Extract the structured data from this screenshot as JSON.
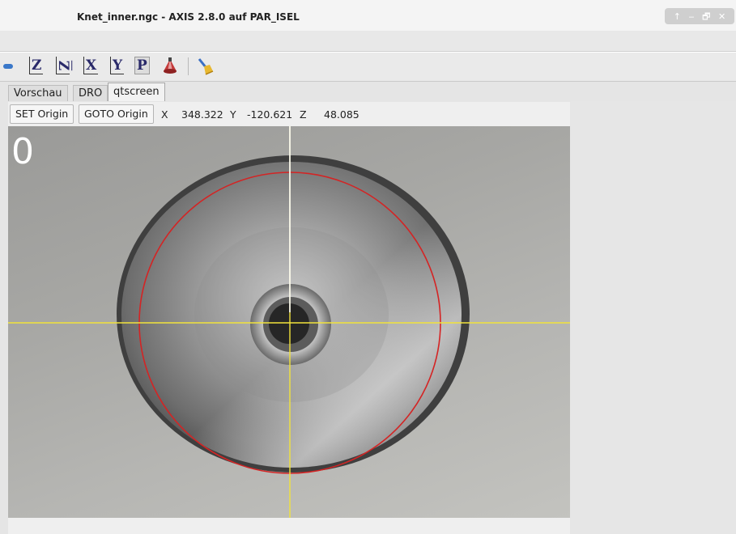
{
  "window": {
    "title": "Knet_inner.ngc - AXIS 2.8.0 auf  PAR_ISEL",
    "controls": [
      "↑",
      "‒",
      "🗗",
      "✕"
    ]
  },
  "toolbar": {
    "items": [
      {
        "name": "stop-bar-icon"
      },
      {
        "name": "view-z-button",
        "label": "Z"
      },
      {
        "name": "view-z-rotated-button",
        "label": "Z"
      },
      {
        "name": "view-x-button",
        "label": "X"
      },
      {
        "name": "view-y-button",
        "label": "Y"
      },
      {
        "name": "view-p-button",
        "label": "P"
      },
      {
        "name": "tool-cone-icon"
      },
      {
        "name": "clear-plot-brush-icon"
      }
    ]
  },
  "tabs": [
    {
      "label": "Vorschau",
      "active": false
    },
    {
      "label": "DRO",
      "active": false
    },
    {
      "label": "qtscreen",
      "active": true
    }
  ],
  "origin_bar": {
    "set_origin": "SET Origin",
    "goto_origin": "GOTO Origin",
    "x_label": "X",
    "x_value": "348.322",
    "y_label": "Y",
    "y_value": "-120.621",
    "z_label": "Z",
    "z_value": "48.085"
  },
  "camera": {
    "frame_label": "0",
    "crosshair_color": "#f2e33a",
    "circle_color": "#d42424"
  }
}
